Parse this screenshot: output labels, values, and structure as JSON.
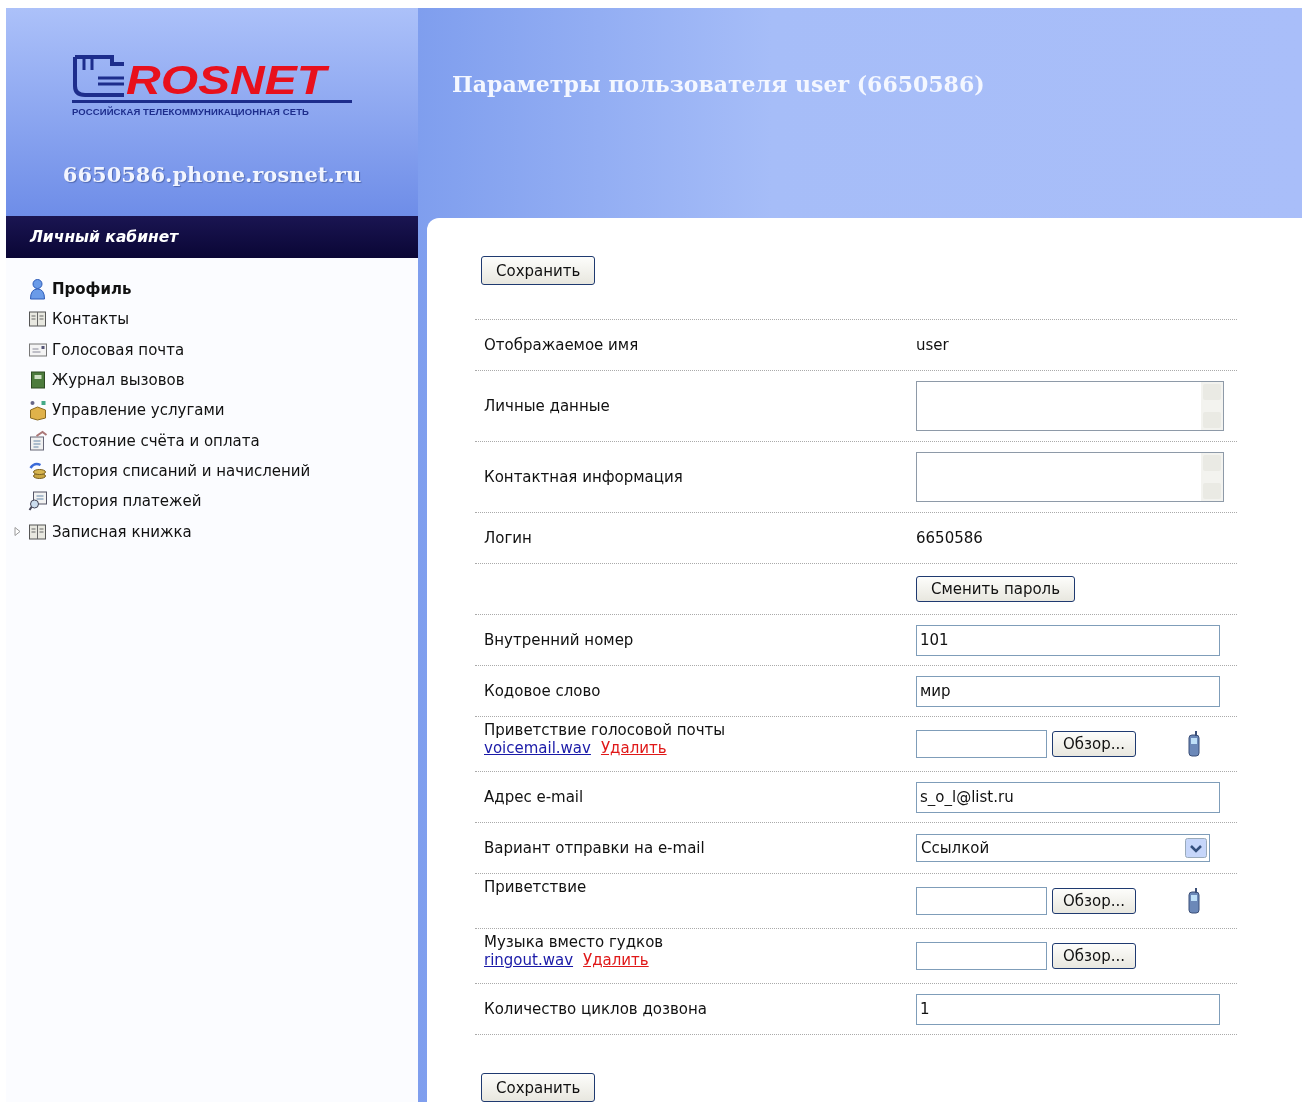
{
  "logo": {
    "wordmark": "ROSNET",
    "tagline": "РОССИЙСКАЯ ТЕЛЕКОММУНИКАЦИОННАЯ СЕТЬ"
  },
  "host": "6650586.phone.rosnet.ru",
  "sidebar": {
    "title": "Личный кабинет",
    "items": [
      {
        "label": "Профиль",
        "selected": true
      },
      {
        "label": "Контакты",
        "selected": false
      },
      {
        "label": "Голосовая почта",
        "selected": false
      },
      {
        "label": "Журнал вызовов",
        "selected": false
      },
      {
        "label": "Управление услугами",
        "selected": false
      },
      {
        "label": "Состояние счёта и оплата",
        "selected": false
      },
      {
        "label": "История списаний и начислений",
        "selected": false
      },
      {
        "label": "История платежей",
        "selected": false
      },
      {
        "label": "Записная книжка",
        "selected": false,
        "expanded": false
      }
    ]
  },
  "page_title": "Параметры пользователя user (6650586)",
  "save_button_top": "Сохранить",
  "form": [
    {
      "kind": "text",
      "label": "Отображаемое имя",
      "value": "user"
    },
    {
      "kind": "textarea",
      "label": "Личные данные"
    },
    {
      "kind": "textarea",
      "label": "Контактная информация"
    },
    {
      "kind": "text",
      "label": "Логин",
      "value": "6650586"
    },
    {
      "kind": "button",
      "button": "Сменить пароль"
    },
    {
      "kind": "input",
      "label": "Внутренний номер",
      "value": "101"
    },
    {
      "kind": "input",
      "label": "Кодовое слово",
      "value": "мир"
    },
    {
      "kind": "file",
      "label": "Приветствие голосовой почты",
      "file": "voicemail.wav",
      "delete": "Удалить",
      "browse": "Обзор...",
      "player": true
    },
    {
      "kind": "input",
      "label": "Адрес e-mail",
      "value": "s_o_l@list.ru"
    },
    {
      "kind": "select",
      "label": "Вариант отправки на e-mail",
      "value": "Ссылкой"
    },
    {
      "kind": "file",
      "label": "Приветствие",
      "browse": "Обзор...",
      "player": true
    },
    {
      "kind": "file",
      "label": "Музыка вместо гудков",
      "file": "ringout.wav",
      "delete": "Удалить",
      "browse": "Обзор...",
      "player": false
    },
    {
      "kind": "input",
      "label": "Количество циклов дозвона",
      "value": "1"
    }
  ],
  "save_button_bottom": "Сохранить"
}
